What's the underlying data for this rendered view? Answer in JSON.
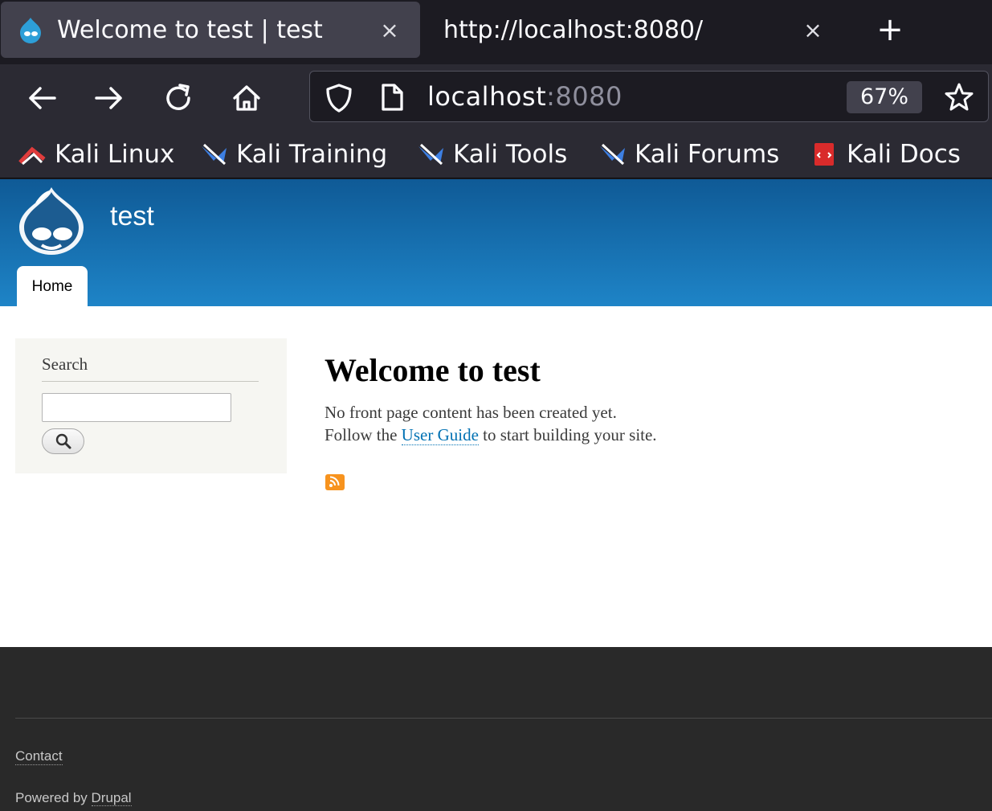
{
  "browser": {
    "tabs": [
      {
        "title": "Welcome to test | test",
        "close_glyph": "×",
        "active": true,
        "icon": "drupal-favicon-icon"
      },
      {
        "title": "http://localhost:8080/",
        "close_glyph": "×",
        "active": false
      }
    ],
    "new_tab_glyph": "+",
    "url_host": "localhost",
    "url_port": ":8080",
    "zoom": "67%",
    "bookmarks": [
      {
        "label": "Kali Linux",
        "icon": "kali-linux-icon"
      },
      {
        "label": "Kali Training",
        "icon": "kali-training-icon"
      },
      {
        "label": "Kali Tools",
        "icon": "kali-tools-icon"
      },
      {
        "label": "Kali Forums",
        "icon": "kali-forums-icon"
      },
      {
        "label": "Kali Docs",
        "icon": "kali-docs-icon"
      }
    ]
  },
  "site": {
    "name": "test",
    "nav": [
      {
        "label": "Home"
      }
    ],
    "search_block_title": "Search",
    "search_value": "",
    "main": {
      "title": "Welcome to test",
      "line1": "No front page content has been created yet.",
      "line2_before": "Follow the ",
      "line2_link": "User Guide",
      "line2_after": " to start building your site."
    },
    "footer": {
      "contact": "Contact",
      "powered_by": "Powered by ",
      "drupal": "Drupal"
    }
  },
  "colors": {
    "header_top": "#0f5a96",
    "header_bottom": "#1e84c7",
    "link": "#0071b3",
    "footer_bg": "#292929",
    "feed_icon": "#f7931e"
  }
}
